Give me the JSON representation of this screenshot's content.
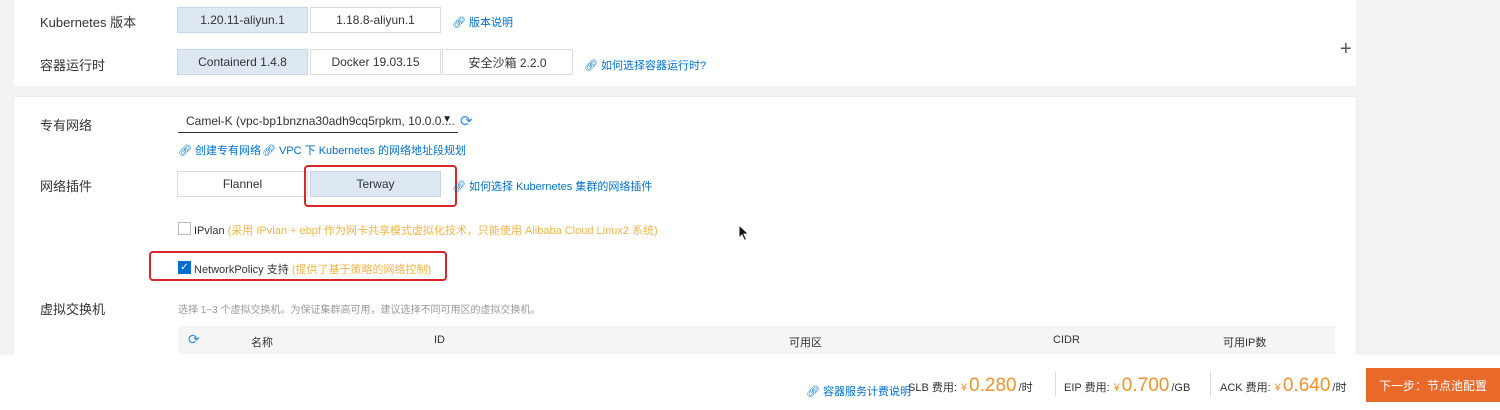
{
  "k8s": {
    "label": "Kubernetes 版本",
    "options": [
      "1.20.11-aliyun.1",
      "1.18.8-aliyun.1"
    ],
    "selected": "1.20.11-aliyun.1",
    "link": "版本说明"
  },
  "runtime": {
    "label": "容器运行时",
    "options": [
      "Containerd 1.4.8",
      "Docker 19.03.15",
      "安全沙箱 2.2.0"
    ],
    "selected": "Containerd 1.4.8",
    "link": "如何选择容器运行时?"
  },
  "vpc": {
    "label": "专有网络",
    "value": "Camel-K (vpc-bp1bnzna30adh9cq5rpkm, 10.0.0....",
    "link_create": "创建专有网络",
    "link_plan": "VPC 下 Kubernetes 的网络地址段规划"
  },
  "plugin": {
    "label": "网络插件",
    "options": [
      "Flannel",
      "Terway"
    ],
    "selected": "Terway",
    "link": "如何选择 Kubernetes 集群的网络插件"
  },
  "ipvlan": {
    "label": "IPvlan",
    "hint": "(采用 IPvlan + ebpf 作为网卡共享模式虚拟化技术，只能使用 Alibaba Cloud Linux2 系统)",
    "checked": false
  },
  "netpolicy": {
    "label": "NetworkPolicy 支持",
    "hint": "(提供了基于策略的网络控制)",
    "checked": true
  },
  "vswitch": {
    "label": "虚拟交换机",
    "desc": "选择 1~3 个虚拟交换机。为保证集群高可用，建议选择不同可用区的虚拟交换机。",
    "columns": [
      "名称",
      "ID",
      "可用区",
      "CIDR",
      "可用IP数"
    ]
  },
  "footer": {
    "pricing_link": "容器服务计费说明",
    "slb_label": "SLB 费用:",
    "slb_price": "0.280",
    "slb_unit": "/时",
    "eip_label": "EIP 费用:",
    "eip_price": "0.700",
    "eip_unit": "/GB",
    "ack_label": "ACK 费用:",
    "ack_price": "0.640",
    "ack_unit": "/时",
    "currency": "¥",
    "next_button": "下一步：节点池配置"
  },
  "colors": {
    "accent": "#0070cc",
    "selected_bg": "#dde8f3",
    "highlight_red": "#d9252b",
    "price_orange": "#f0932d",
    "next_button": "#e8692a"
  }
}
